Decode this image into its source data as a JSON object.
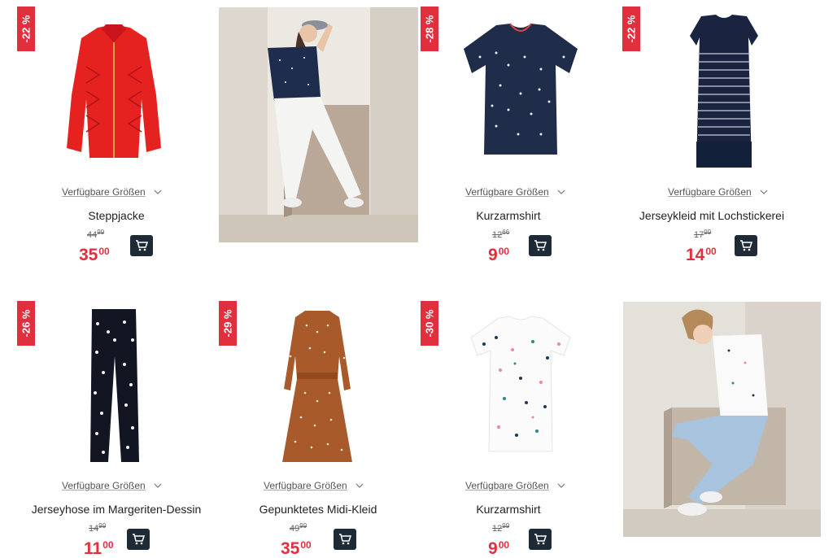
{
  "products": [
    {
      "discount": "-22 %",
      "sizes_label": "Verfügbare Größen",
      "name": "Steppjacke",
      "old_price_int": "44",
      "old_price_dec": "99",
      "new_price_int": "35",
      "new_price_dec": "00"
    },
    {
      "discount": "-28 %",
      "sizes_label": "Verfügbare Größen",
      "name": "Kurzarmshirt",
      "old_price_int": "12",
      "old_price_dec": "66",
      "new_price_int": "9",
      "new_price_dec": "00"
    },
    {
      "discount": "-22 %",
      "sizes_label": "Verfügbare Größen",
      "name": "Jerseykleid mit Lochstickerei",
      "old_price_int": "17",
      "old_price_dec": "99",
      "new_price_int": "14",
      "new_price_dec": "00"
    },
    {
      "discount": "-26 %",
      "sizes_label": "Verfügbare Größen",
      "name": "Jerseyhose im Margeriten-Dessin",
      "old_price_int": "14",
      "old_price_dec": "99",
      "new_price_int": "11",
      "new_price_dec": "00"
    },
    {
      "discount": "-29 %",
      "sizes_label": "Verfügbare Größen",
      "name": "Gepunktetes Midi-Kleid",
      "old_price_int": "49",
      "old_price_dec": "99",
      "new_price_int": "35",
      "new_price_dec": "00"
    },
    {
      "discount": "-30 %",
      "sizes_label": "Verfügbare Größen",
      "name": "Kurzarmshirt",
      "old_price_int": "12",
      "old_price_dec": "99",
      "new_price_int": "9",
      "new_price_dec": "00"
    }
  ],
  "icons": {
    "cart": "shopping-cart-icon",
    "chevron": "chevron-down-icon"
  },
  "colors": {
    "sale_red": "#e0303e",
    "cart_button": "#1e2a36"
  }
}
